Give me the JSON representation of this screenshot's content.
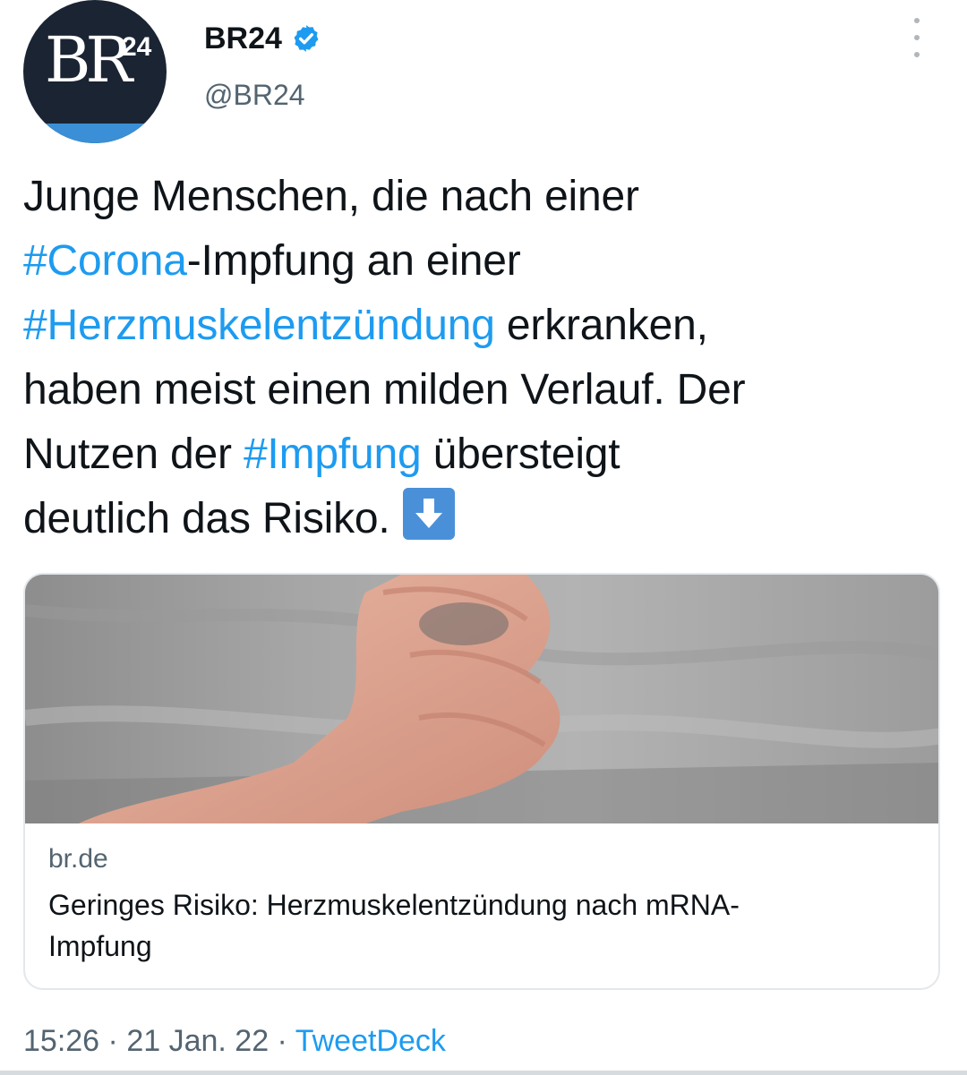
{
  "author": {
    "display_name": "BR24",
    "handle": "@BR24",
    "avatar_logo_main": "BR",
    "avatar_logo_sup": "24"
  },
  "tweet": {
    "lines": [
      [
        {
          "text": "Junge Menschen, die nach einer",
          "tag": false
        }
      ],
      [
        {
          "text": "#Corona",
          "tag": true
        },
        {
          "text": "-Impfung an einer",
          "tag": false
        }
      ],
      [
        {
          "text": "#Herzmuskelentzündung",
          "tag": true
        },
        {
          "text": " erkranken,",
          "tag": false
        }
      ],
      [
        {
          "text": "haben meist einen milden Verlauf. Der",
          "tag": false
        }
      ],
      [
        {
          "text": "Nutzen der ",
          "tag": false
        },
        {
          "text": "#Impfung",
          "tag": true
        },
        {
          "text": " übersteigt",
          "tag": false
        }
      ],
      [
        {
          "text": "deutlich das Risiko.",
          "tag": false
        }
      ]
    ],
    "emoji_icon": "down-arrow-emoji"
  },
  "card": {
    "domain": "br.de",
    "title": "Geringes Risiko: Herzmuskelentzündung nach mRNA-Impfung"
  },
  "footer": {
    "time": "15:26",
    "separator": " · ",
    "date": "21 Jan. 22",
    "source": "TweetDeck"
  },
  "colors": {
    "link": "#1d9bf0",
    "text": "#0f1419",
    "muted": "#536471",
    "avatar_bg": "#1a2433",
    "avatar_stripe": "#3a8fd6",
    "verified": "#1d9bf0",
    "emoji_bg": "#4a90d9"
  }
}
